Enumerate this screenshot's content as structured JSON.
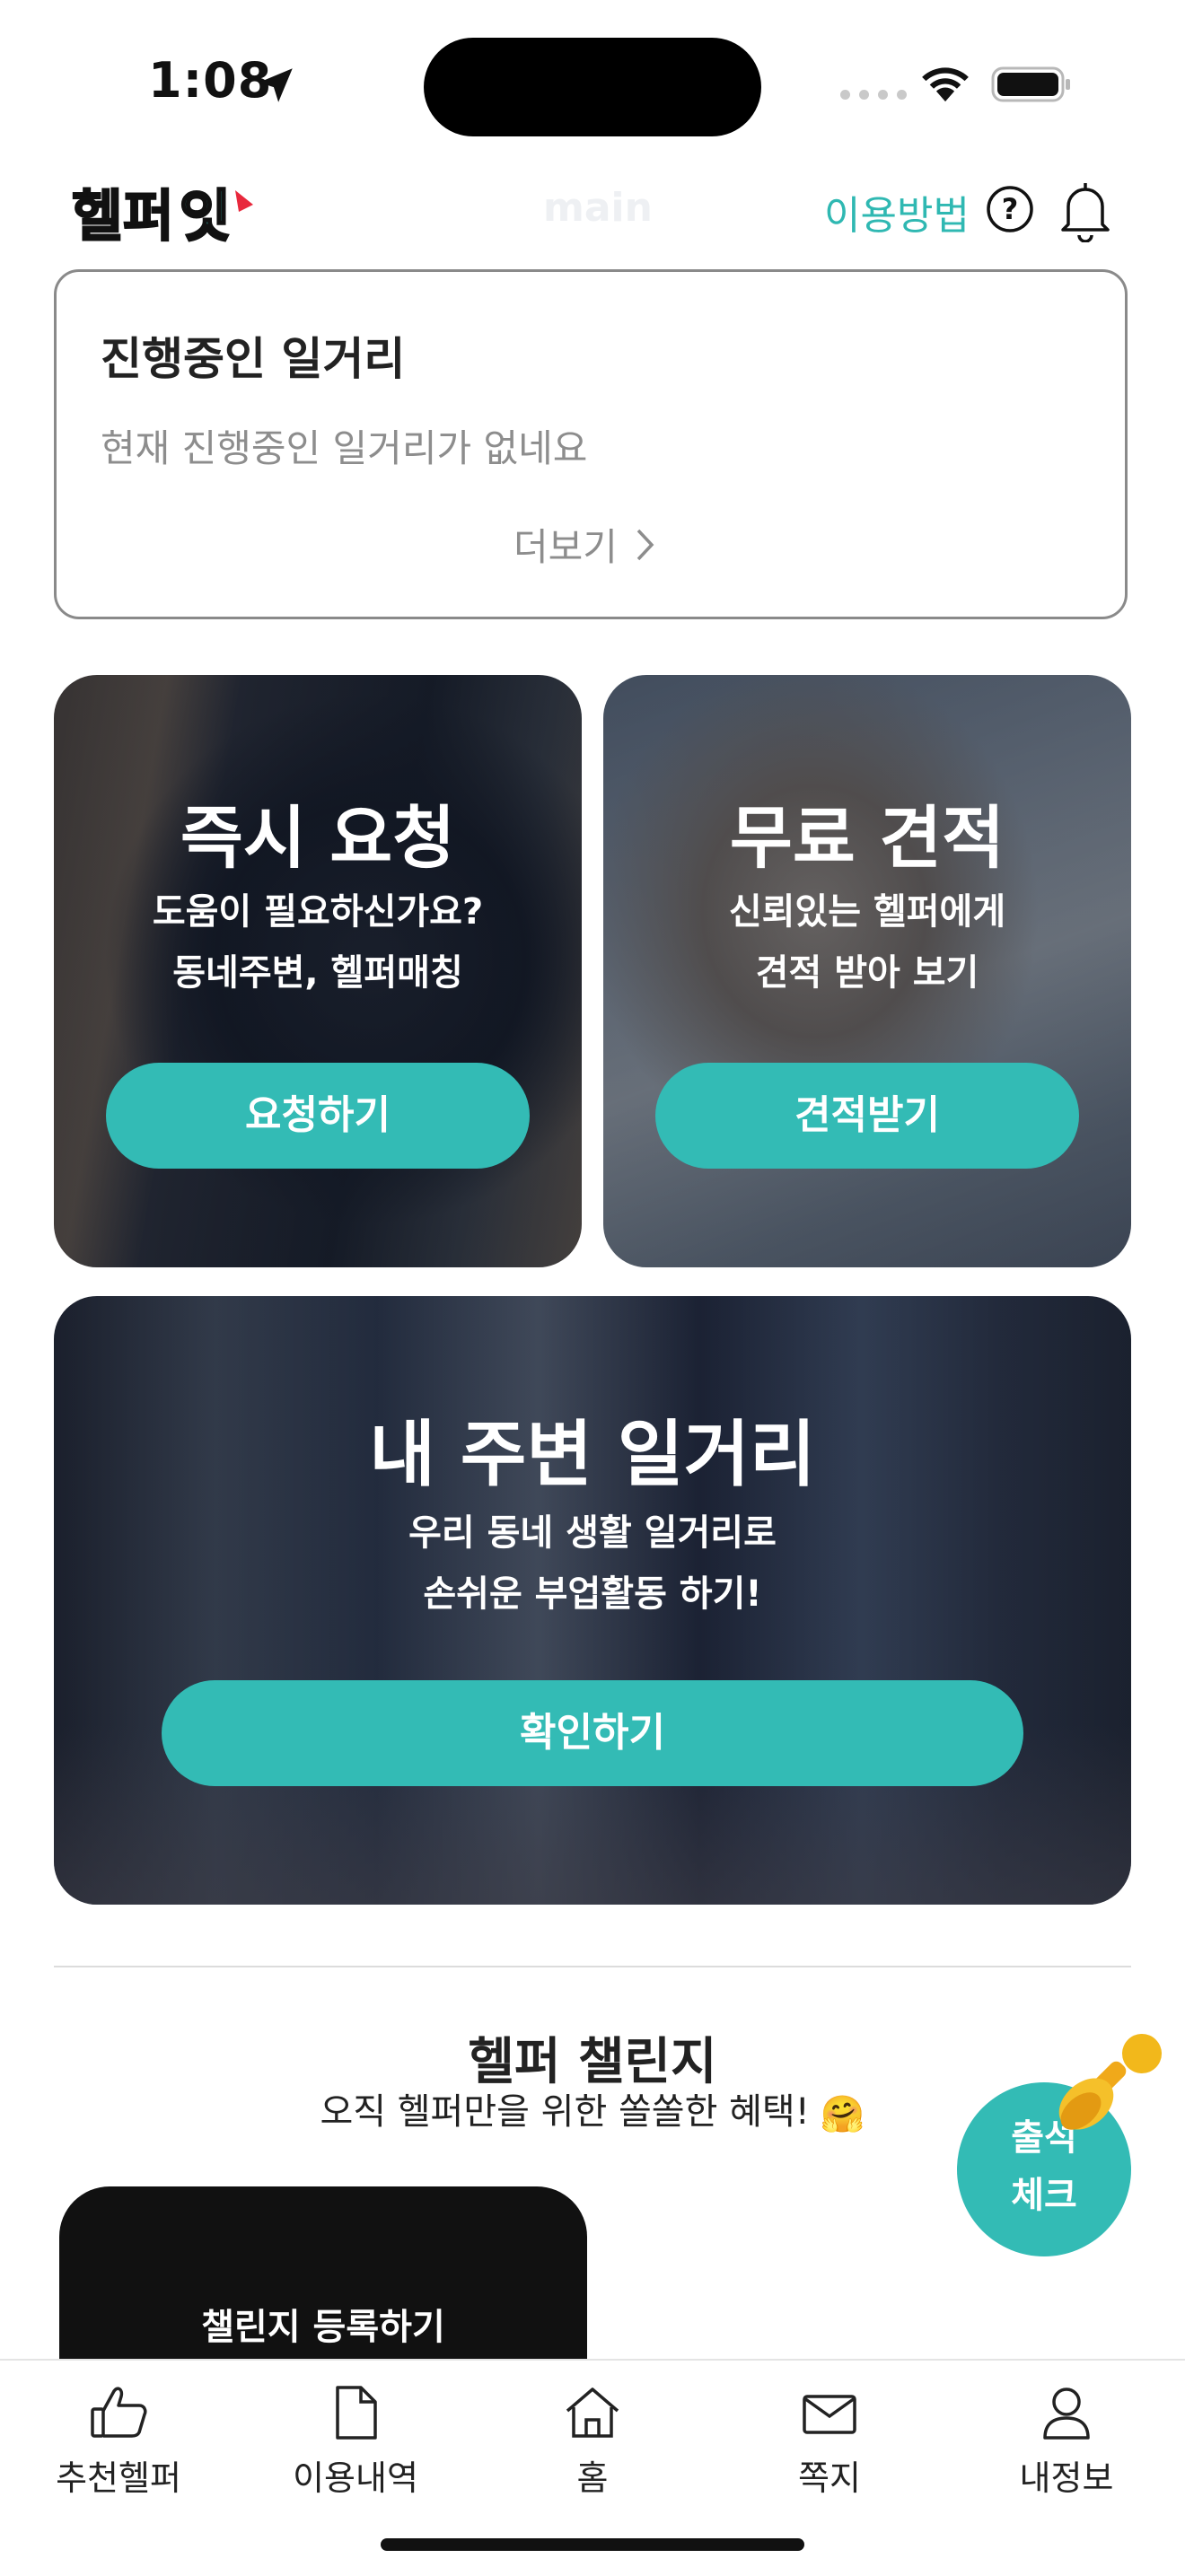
{
  "status_bar": {
    "time": "1:08"
  },
  "header": {
    "logo_text": "헬퍼잇",
    "ghost_title": "main",
    "howto_label": "이용방법"
  },
  "ongoing": {
    "title": "진행중인 일거리",
    "empty_message": "현재 진행중인 일거리가 없네요",
    "more_label": "더보기"
  },
  "cards": {
    "instant": {
      "title": "즉시 요청",
      "line1": "도움이 필요하신가요?",
      "line2": "동네주변, 헬퍼매칭",
      "button": "요청하기"
    },
    "quote": {
      "title": "무료 견적",
      "line1": "신뢰있는 헬퍼에게",
      "line2": "견적 받아 보기",
      "button": "견적받기"
    },
    "nearby": {
      "title": "내 주변 일거리",
      "line1": "우리 동네 생활 일거리로",
      "line2": "손쉬운 부업활동 하기!",
      "button": "확인하기"
    }
  },
  "challenge": {
    "title": "헬퍼 챌린지",
    "subtitle": "오직 헬퍼만을 위한 쏠쏠한 혜택!",
    "emoji": "🤗",
    "card_label": "챌린지 등록하기"
  },
  "attendance": {
    "line1": "출석",
    "line2": "체크"
  },
  "bottom_nav": [
    {
      "label": "추천헬퍼",
      "icon": "thumbs-up-icon"
    },
    {
      "label": "이용내역",
      "icon": "document-icon"
    },
    {
      "label": "홈",
      "icon": "home-icon"
    },
    {
      "label": "쪽지",
      "icon": "mail-icon"
    },
    {
      "label": "내정보",
      "icon": "person-icon"
    }
  ],
  "colors": {
    "accent": "#33bbb5",
    "text": "#222222",
    "muted": "#8d8d8d"
  }
}
